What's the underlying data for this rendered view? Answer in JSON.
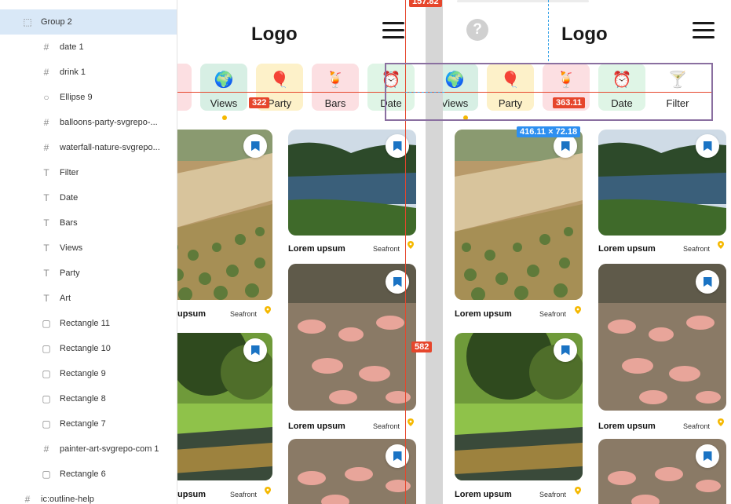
{
  "layers": {
    "items": [
      {
        "label": "",
        "type": "frame",
        "selected": false
      },
      {
        "label": "Group 2",
        "type": "group",
        "selected": true
      },
      {
        "label": "date 1",
        "type": "frame",
        "selected": false
      },
      {
        "label": "drink 1",
        "type": "frame",
        "selected": false
      },
      {
        "label": "Ellipse 9",
        "type": "ellipse",
        "selected": false
      },
      {
        "label": "balloons-party-svgrepo-...",
        "type": "frame",
        "selected": false
      },
      {
        "label": "waterfall-nature-svgrepo...",
        "type": "frame",
        "selected": false
      },
      {
        "label": "Filter",
        "type": "text",
        "selected": false
      },
      {
        "label": "Date",
        "type": "text",
        "selected": false
      },
      {
        "label": "Bars",
        "type": "text",
        "selected": false
      },
      {
        "label": "Views",
        "type": "text",
        "selected": false
      },
      {
        "label": "Party",
        "type": "text",
        "selected": false
      },
      {
        "label": "Art",
        "type": "text",
        "selected": false
      },
      {
        "label": "Rectangle 11",
        "type": "rect",
        "selected": false
      },
      {
        "label": "Rectangle 10",
        "type": "rect",
        "selected": false
      },
      {
        "label": "Rectangle 9",
        "type": "rect",
        "selected": false
      },
      {
        "label": "Rectangle 8",
        "type": "rect",
        "selected": false
      },
      {
        "label": "Rectangle 7",
        "type": "rect",
        "selected": false
      },
      {
        "label": "painter-art-svgrepo-com 1",
        "type": "frame",
        "selected": false
      },
      {
        "label": "Rectangle 6",
        "type": "rect",
        "selected": false
      },
      {
        "label": "ic:outline-help",
        "type": "frame",
        "selected": false
      }
    ]
  },
  "app": {
    "logo": "Logo",
    "help_icon": "?"
  },
  "categories_a": [
    {
      "label": "Views",
      "emoji": "🌍",
      "bg": "#d7efe4"
    },
    {
      "label": "Party",
      "emoji": "🎈",
      "bg": "#fdf1c9"
    },
    {
      "label": "Bars",
      "emoji": "🍹",
      "bg": "#fcdfe2"
    },
    {
      "label": "Date",
      "emoji": "⏰",
      "bg": "#dff5e6"
    }
  ],
  "categories_b": [
    {
      "label": "Views",
      "emoji": "🌍",
      "bg": "#d7efe4"
    },
    {
      "label": "Party",
      "emoji": "🎈",
      "bg": "#fdf1c9"
    },
    {
      "label": "Bars",
      "emoji": "🍹",
      "bg": "#fcdfe2"
    },
    {
      "label": "Date",
      "emoji": "⏰",
      "bg": "#dff5e6"
    },
    {
      "label": "Filter",
      "emoji": "🍸",
      "bg": "#ffffff"
    }
  ],
  "cards": {
    "title": "Lorem upsum",
    "place": "Seafront",
    "partial_title": "upsum"
  },
  "measurements": {
    "top_distance": "157.82",
    "width_a": "322",
    "width_b": "363.11",
    "height": "582",
    "selection_size": "416.11 × 72.18"
  },
  "colors": {
    "accent_red": "#e6462c",
    "accent_blue": "#2d8ff0",
    "bookmark": "#1a73c4",
    "pin": "#f5b800",
    "selection": "#d9e8f7"
  }
}
